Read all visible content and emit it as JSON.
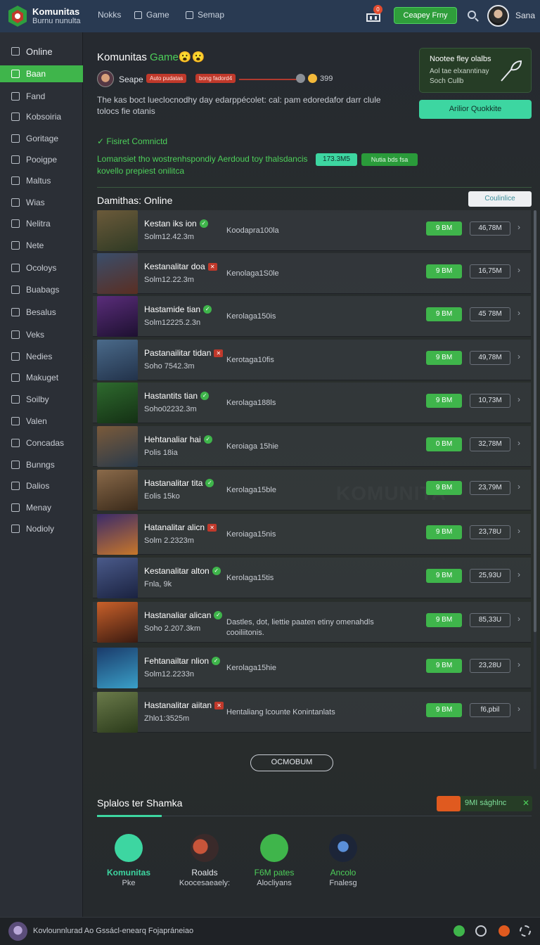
{
  "topbar": {
    "brand_title": "Komunitas",
    "brand_subtitle": "Burnu nunulta",
    "nav": [
      "Nokks",
      "Game",
      "Semap"
    ],
    "cart_count": "0",
    "cta": "Ceapey Frny",
    "user": "Sana",
    "accent": "#4ed061"
  },
  "sidebar": {
    "items": [
      "Online",
      "Baan",
      "Fand",
      "Kobsoiria",
      "Goritage",
      "Pooigpe",
      "Maltus",
      "Wias",
      "Nelitra",
      "Nete",
      "Ocoloys",
      "Buabags",
      "Besalus",
      "Veks",
      "Nedies",
      "Makuget",
      "Soilby",
      "Valen",
      "Concadas",
      "Bunngs",
      "Dalios",
      "Menay",
      "Nodioly"
    ],
    "active_index": 1
  },
  "hero": {
    "title": "Komunitas",
    "title_accent": "Game",
    "title_emoji": "😮😮",
    "username": "Seape",
    "pill1": "Auto pudatas",
    "pill2": "bong fadord4",
    "score": "399",
    "description": "The kas boct lueclocnodhy day edarppécolet: cal: pam edoredafor darr clule tolocs fie otanis",
    "verified": "Fisiret Comnictd",
    "tagline": "Lomansiet tho wostrenhspondiy Aerdoud toy thalsdancis kovello prepiest onilitca",
    "chip1": "173.3M5",
    "chip2": "Nutia bds fsa"
  },
  "promo": {
    "line1": "Nootee fley olalbs",
    "line2": "Aol tae elxanntinay Soch Cullb",
    "button": "Arilior Quokkite"
  },
  "list": {
    "title": "Damithas: Online",
    "action": "Coulinlice",
    "rows": [
      {
        "name": "Kestan iks ion",
        "sub": "Solm12.42.3m",
        "desc": "Koodapra100la",
        "btn": "9 BM",
        "amount": "46,78M",
        "badge": "ok"
      },
      {
        "name": "Kestanalitar doa",
        "sub": "Solm12.22.3m",
        "desc": "Kenolaga1S0le",
        "btn": "9 BM",
        "amount": "16,75M",
        "badge": "x"
      },
      {
        "name": "Hastamide tian",
        "sub": "Solm12225.2.3n",
        "desc": "Kerolaga150is",
        "btn": "9 BM",
        "amount": "45 78M",
        "badge": "ok"
      },
      {
        "name": "Pastanailitar tidan",
        "sub": "Soho 7542.3m",
        "desc": "Kerotaga10fis",
        "btn": "9 BM",
        "amount": "49,78M",
        "badge": "x"
      },
      {
        "name": "Hastantits tian",
        "sub": "Soho02232.3m",
        "desc": "Kerolaga188ls",
        "btn": "9 BM",
        "amount": "10,73M",
        "badge": "ok"
      },
      {
        "name": "Hehtanaliar hai",
        "sub": "Polis 18ia",
        "desc": "Keroiaga 15hie",
        "btn": "0 BM",
        "amount": "32,78M",
        "badge": "ok"
      },
      {
        "name": "Hastanalitar tita",
        "sub": "Eolis 15ko",
        "desc": "Kerolaga15ble",
        "btn": "9 BM",
        "amount": "23,79M",
        "badge": "ok"
      },
      {
        "name": "Hatanalitar alicn",
        "sub": "Solm 2.2323m",
        "desc": "Keroiaga15nis",
        "btn": "9 BM",
        "amount": "23,78U",
        "badge": "x"
      },
      {
        "name": "Kestanalitar alton",
        "sub": "Fnla, 9k",
        "desc": "Kerolaga15tis",
        "btn": "9 BM",
        "amount": "25,93U",
        "badge": "ok"
      },
      {
        "name": "Hastanaliar alican",
        "sub": "Soho 2.207.3km",
        "desc": "Dastles, dot, liettie paaten etiny omenahdls cooiliitonis.",
        "btn": "9 BM",
        "amount": "85,33U",
        "badge": "ok"
      },
      {
        "name": "Fehtanailtar nlion",
        "sub": "Solm12.2233n",
        "desc": "Kerolaga15hie",
        "btn": "9 BM",
        "amount": "23,28U",
        "badge": "ok"
      },
      {
        "name": "Hastanalitar aiitan",
        "sub": "Zhlo1:3525m",
        "desc": "Hentaliang lcounte Konintanlats",
        "btn": "9 BM",
        "amount": "f6,pbil",
        "badge": "x"
      }
    ],
    "load_more": "OCMOBUM"
  },
  "bottom": {
    "title": "Splalos ter Shamka",
    "notice": "9MI sághlnc",
    "apps": [
      {
        "name": "Komunitas",
        "sub": "Pke",
        "color": "#3dd6a1"
      },
      {
        "name": "Roalds",
        "sub": "Koocesaeaely:",
        "color": "#e6e9ee"
      },
      {
        "name": "F6M pates",
        "sub": "Alocliyans",
        "color": "#4dcf5a"
      },
      {
        "name": "Ancolo",
        "sub": "Fnalesg",
        "color": "#4dcf5a"
      }
    ]
  },
  "footer": {
    "text": "Kovlounnlurad Ao Gssácl-enearq Fojapráneiao"
  }
}
